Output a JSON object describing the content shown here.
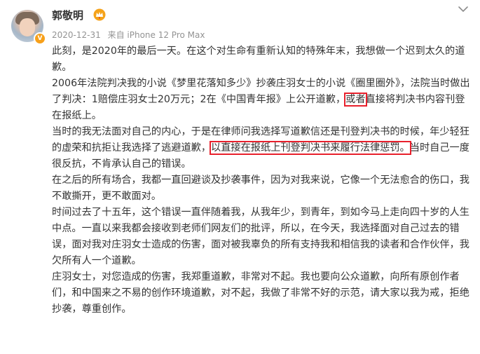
{
  "author": {
    "name": "郭敬明",
    "date": "2020-12-31",
    "source": "来自 iPhone 12 Pro Max"
  },
  "icons": {
    "vip": "vip-crown-icon",
    "verified": "verified-badge-icon",
    "more": "chevron-down-icon"
  },
  "colors": {
    "highlight": "#e8202c",
    "badge": "#f7a01a"
  },
  "post": {
    "p1": "此刻，是2020年的最后一天。在这个对生命有重新认知的特殊年末，我想做一个迟到太久的道歉。",
    "p2a": "2006年法院判决我的小说《梦里花落知多少》抄袭庄羽女士的小说《圈里圈外》，法院当时做出了判决：1赔偿庄羽女士20万元；2在《中国青年报》上公开道歉，",
    "p2hl": "或者",
    "p2b": "直接将判决书内容刊登在报纸上。",
    "p3a": "当时的我无法面对自己的内心，于是在律师问我选择写道歉信还是刊登判决书的时候，年少轻狂的虚荣和抗拒让我选择了逃避道歉，",
    "p3hl": "以直接在报纸上刊登判决书来履行法律惩罚。",
    "p3b": "当时自己一度很反抗，不肯承认自己的错误。",
    "p4": "在之后的所有场合，我都一直回避谈及抄袭事件，因为对我来说，它像一个无法愈合的伤口，我不敢撕开，更不敢面对。",
    "p5": "时间过去了十五年，这个错误一直伴随着我，从我年少，到青年，到如今马上走向四十岁的人生中点。一直以来我都会接收到老师们网友们的批评，所以，在今天，我选择面对自己过去的错误，面对我对庄羽女士造成的伤害，面对被我辜负的所有支持我和相信我的读者和合作伙伴，我欠所有人一个道歉。",
    "p6": "庄羽女士，对您造成的伤害，我郑重道歉，非常对不起。我也要向公众道歉，向所有原创作者们，和中国来之不易的创作环境道歉，对不起，我做了非常不好的示范，请大家以我为戒，拒绝抄袭，尊重创作。"
  }
}
